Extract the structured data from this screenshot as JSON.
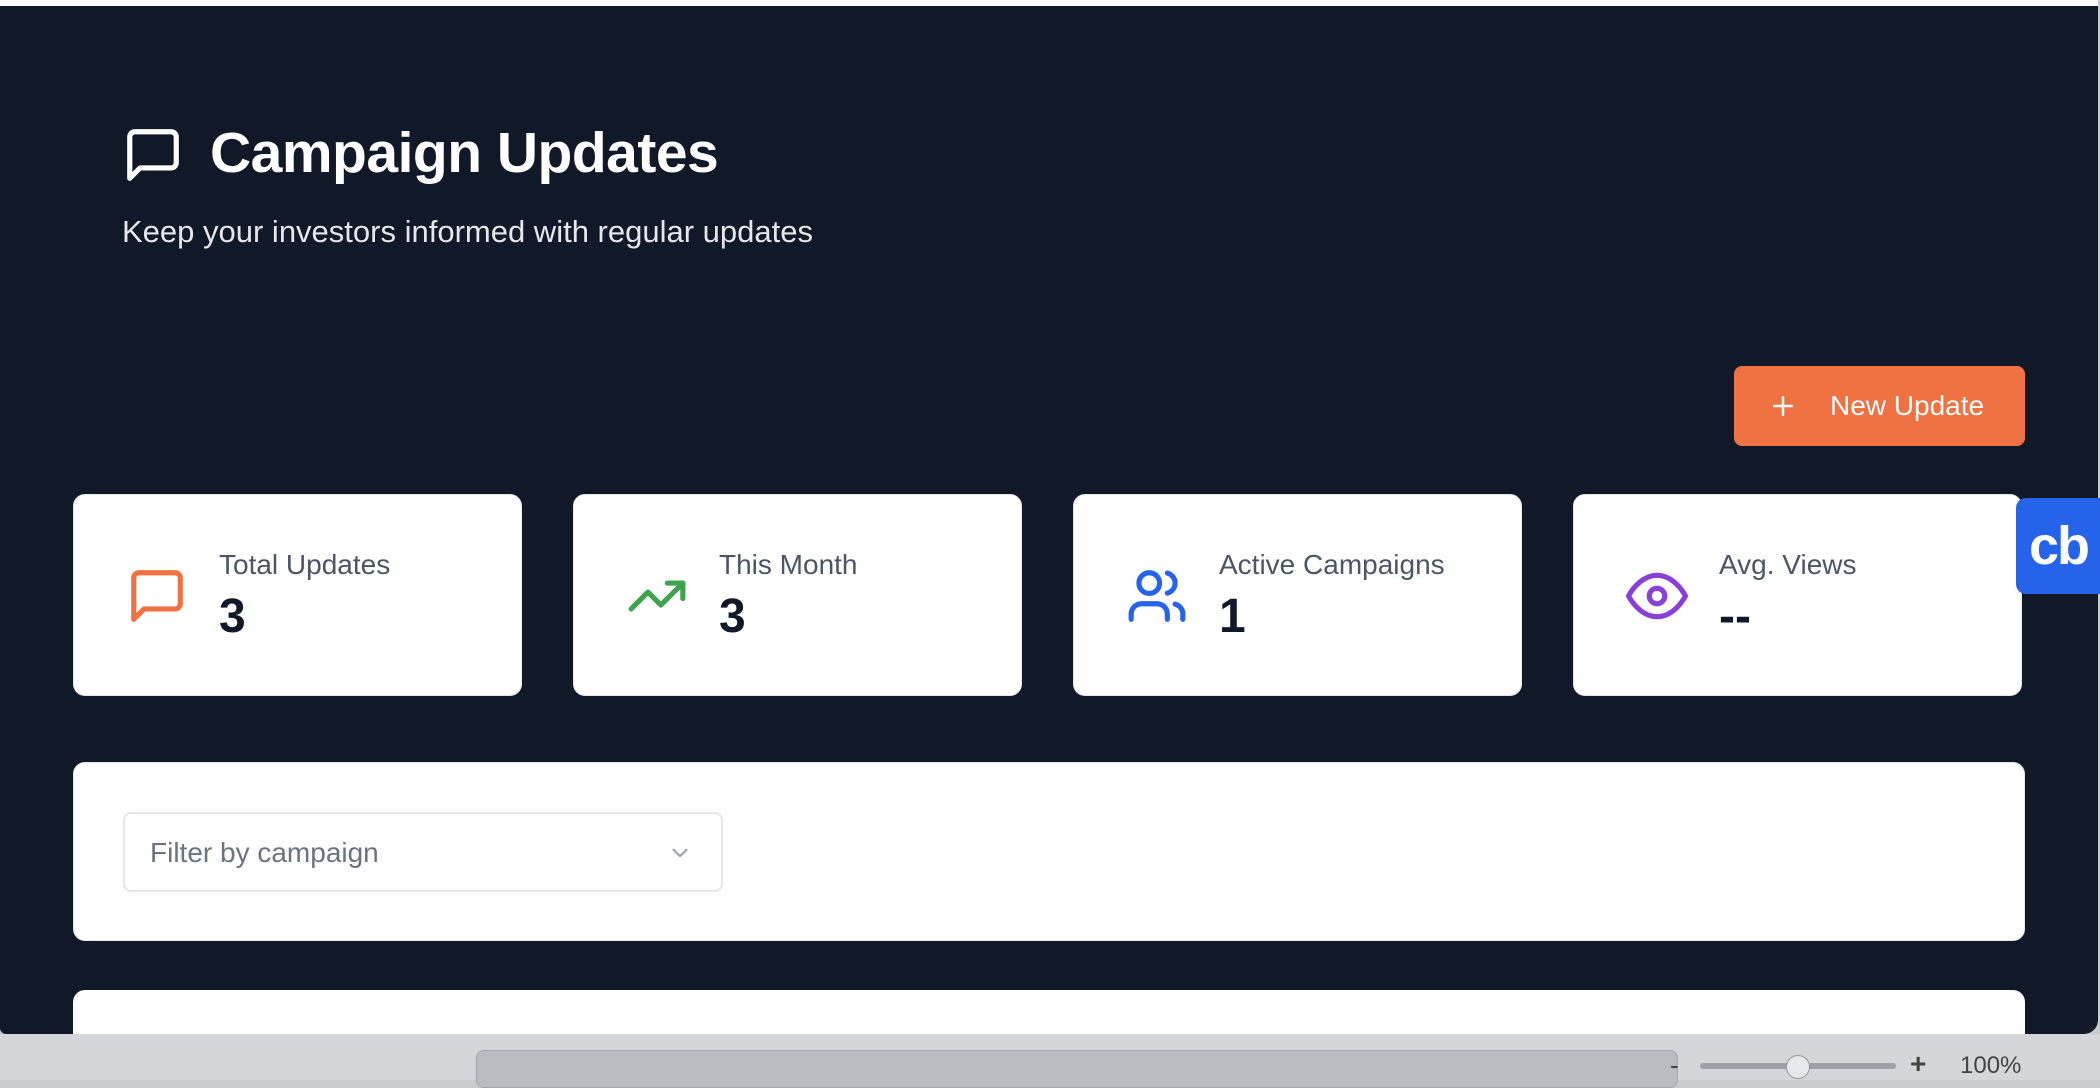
{
  "header": {
    "title": "Campaign Updates",
    "subtitle": "Keep your investors informed with regular updates",
    "icon": "message-square-icon"
  },
  "actions": {
    "new_update_label": "New Update",
    "new_update_icon": "plus-icon"
  },
  "stats": [
    {
      "label": "Total Updates",
      "value": "3",
      "icon": "message-square-icon",
      "color": "#f07243"
    },
    {
      "label": "This Month",
      "value": "3",
      "icon": "trending-up-icon",
      "color": "#3fa34d"
    },
    {
      "label": "Active Campaigns",
      "value": "1",
      "icon": "users-icon",
      "color": "#2563eb"
    },
    {
      "label": "Avg. Views",
      "value": "--",
      "icon": "eye-icon",
      "color": "#8b3fd9"
    }
  ],
  "filter": {
    "placeholder": "Filter by campaign"
  },
  "widget": {
    "label": "cb"
  },
  "bottom_bar": {
    "zoom_minus": "-",
    "zoom_plus": "+",
    "zoom_level": "100%"
  },
  "colors": {
    "background": "#111827",
    "accent": "#f07243",
    "card": "#ffffff"
  }
}
